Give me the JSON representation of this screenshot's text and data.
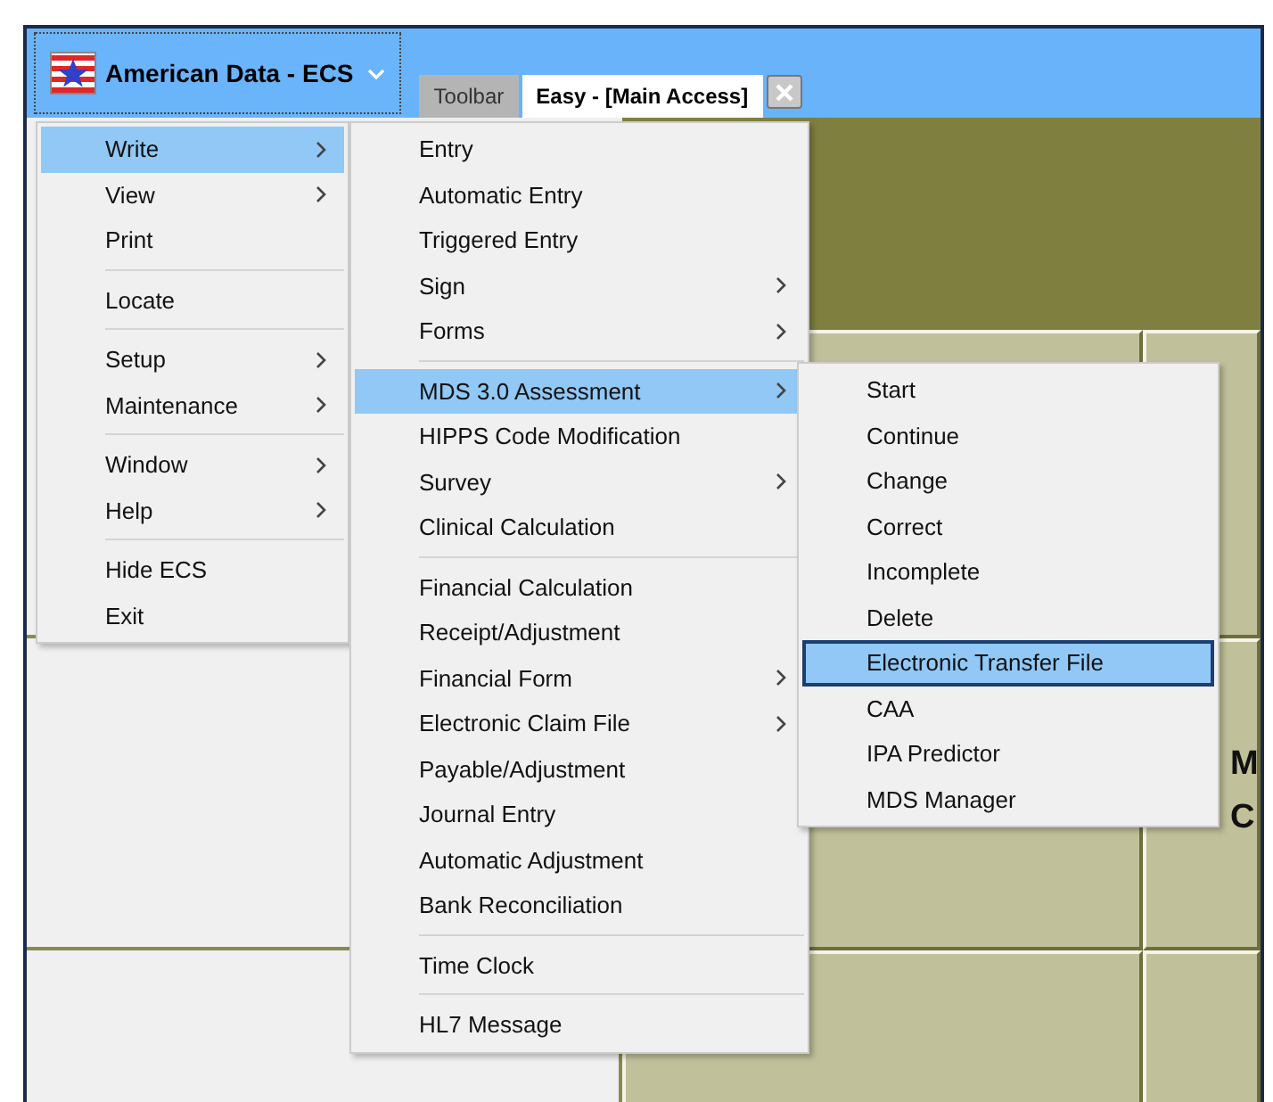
{
  "app_button": {
    "label": "American Data - ECS"
  },
  "tabs": [
    {
      "label": "Toolbar",
      "selected": false
    },
    {
      "label": "Easy - [Main Access]",
      "selected": true
    }
  ],
  "tile_texts": [
    "M",
    "C"
  ],
  "menus": [
    {
      "items": [
        {
          "kind": "item",
          "label": "Write",
          "submenu": true,
          "selected": true
        },
        {
          "kind": "item",
          "label": "View",
          "submenu": true,
          "selected": false
        },
        {
          "kind": "item",
          "label": "Print",
          "submenu": false,
          "selected": false
        },
        {
          "kind": "separator"
        },
        {
          "kind": "item",
          "label": "Locate",
          "submenu": false,
          "selected": false
        },
        {
          "kind": "separator"
        },
        {
          "kind": "item",
          "label": "Setup",
          "submenu": true,
          "selected": false
        },
        {
          "kind": "item",
          "label": "Maintenance",
          "submenu": true,
          "selected": false
        },
        {
          "kind": "separator"
        },
        {
          "kind": "item",
          "label": "Window",
          "submenu": true,
          "selected": false
        },
        {
          "kind": "item",
          "label": "Help",
          "submenu": true,
          "selected": false
        },
        {
          "kind": "separator"
        },
        {
          "kind": "item",
          "label": "Hide ECS",
          "submenu": false,
          "selected": false
        },
        {
          "kind": "item",
          "label": "Exit",
          "submenu": false,
          "selected": false
        }
      ]
    },
    {
      "items": [
        {
          "kind": "item",
          "label": "Entry",
          "submenu": false,
          "selected": false
        },
        {
          "kind": "item",
          "label": "Automatic Entry",
          "submenu": false,
          "selected": false
        },
        {
          "kind": "item",
          "label": "Triggered Entry",
          "submenu": false,
          "selected": false
        },
        {
          "kind": "item",
          "label": "Sign",
          "submenu": true,
          "selected": false
        },
        {
          "kind": "item",
          "label": "Forms",
          "submenu": true,
          "selected": false
        },
        {
          "kind": "separator"
        },
        {
          "kind": "item",
          "label": "MDS 3.0 Assessment",
          "submenu": true,
          "selected": true
        },
        {
          "kind": "item",
          "label": "HIPPS Code Modification",
          "submenu": false,
          "selected": false
        },
        {
          "kind": "item",
          "label": "Survey",
          "submenu": true,
          "selected": false
        },
        {
          "kind": "item",
          "label": "Clinical Calculation",
          "submenu": false,
          "selected": false
        },
        {
          "kind": "separator"
        },
        {
          "kind": "item",
          "label": "Financial Calculation",
          "submenu": false,
          "selected": false
        },
        {
          "kind": "item",
          "label": "Receipt/Adjustment",
          "submenu": false,
          "selected": false
        },
        {
          "kind": "item",
          "label": "Financial Form",
          "submenu": true,
          "selected": false
        },
        {
          "kind": "item",
          "label": "Electronic Claim File",
          "submenu": true,
          "selected": false
        },
        {
          "kind": "item",
          "label": "Payable/Adjustment",
          "submenu": false,
          "selected": false
        },
        {
          "kind": "item",
          "label": "Journal Entry",
          "submenu": false,
          "selected": false
        },
        {
          "kind": "item",
          "label": "Automatic Adjustment",
          "submenu": false,
          "selected": false
        },
        {
          "kind": "item",
          "label": "Bank Reconciliation",
          "submenu": false,
          "selected": false
        },
        {
          "kind": "separator"
        },
        {
          "kind": "item",
          "label": "Time Clock",
          "submenu": false,
          "selected": false
        },
        {
          "kind": "separator"
        },
        {
          "kind": "item",
          "label": "HL7 Message",
          "submenu": false,
          "selected": false
        }
      ]
    },
    {
      "items": [
        {
          "kind": "item",
          "label": "Start",
          "submenu": false,
          "selected": false
        },
        {
          "kind": "item",
          "label": "Continue",
          "submenu": false,
          "selected": false
        },
        {
          "kind": "item",
          "label": "Change",
          "submenu": false,
          "selected": false
        },
        {
          "kind": "item",
          "label": "Correct",
          "submenu": false,
          "selected": false
        },
        {
          "kind": "item",
          "label": "Incomplete",
          "submenu": false,
          "selected": false
        },
        {
          "kind": "item",
          "label": "Delete",
          "submenu": false,
          "selected": false
        },
        {
          "kind": "item",
          "label": "Electronic Transfer File",
          "submenu": false,
          "selected": true
        },
        {
          "kind": "item",
          "label": "CAA",
          "submenu": false,
          "selected": false
        },
        {
          "kind": "item",
          "label": "IPA Predictor",
          "submenu": false,
          "selected": false
        },
        {
          "kind": "item",
          "label": "MDS Manager",
          "submenu": false,
          "selected": false
        }
      ]
    }
  ]
}
